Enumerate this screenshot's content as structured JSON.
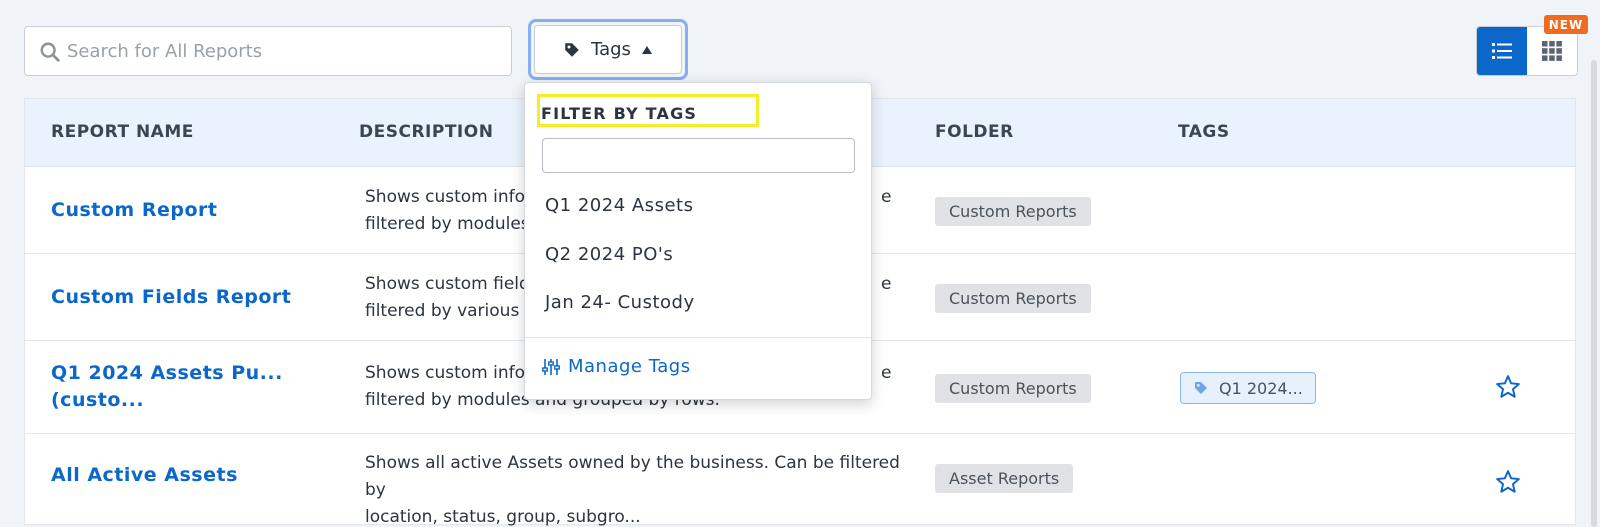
{
  "search": {
    "placeholder": "Search for All Reports"
  },
  "tags_button": {
    "label": "Tags"
  },
  "view_toggle": {
    "badge": "NEW",
    "active": "list"
  },
  "table": {
    "headers": [
      "REPORT NAME",
      "DESCRIPTION",
      "FOLDER",
      "TAGS"
    ],
    "rows": [
      {
        "name": "Custom Report",
        "desc_line1": "Shows custom infor",
        "desc_line2": "filtered by modules",
        "folder": "Custom Reports",
        "tag": "",
        "starred": false
      },
      {
        "name": "Custom Fields Report",
        "desc_line1": "Shows custom fields",
        "desc_line2": "filtered by various It",
        "folder": "Custom Reports",
        "tag": "",
        "starred": false
      },
      {
        "name_line1": "Q1 2024 Assets Pu...",
        "name_line2": "(custo...",
        "desc_line1": "Shows custom infor",
        "desc_line2": "filtered by modules and grouped by rows.",
        "folder": "Custom Reports",
        "tag": "Q1 2024...",
        "starred": true
      },
      {
        "name": "All Active Assets",
        "desc_line1": "Shows all active Assets owned by the business. Can be filtered by",
        "desc_line2": "location, status, group, subgro...",
        "folder": "Asset Reports",
        "tag": "",
        "starred": true
      }
    ],
    "row_overflow_suffix": [
      "e",
      "e",
      "e"
    ]
  },
  "dropdown": {
    "title": "FILTER BY TAGS",
    "filter_value": "",
    "options": [
      "Q1 2024 Assets",
      "Q2 2024 PO's",
      "Jan 24- Custody"
    ],
    "manage_label": "Manage Tags"
  },
  "colors": {
    "accent": "#0b67c9",
    "badge": "#ef6b1f",
    "highlight": "#f3ee25",
    "focus_ring": "#86aef0"
  }
}
